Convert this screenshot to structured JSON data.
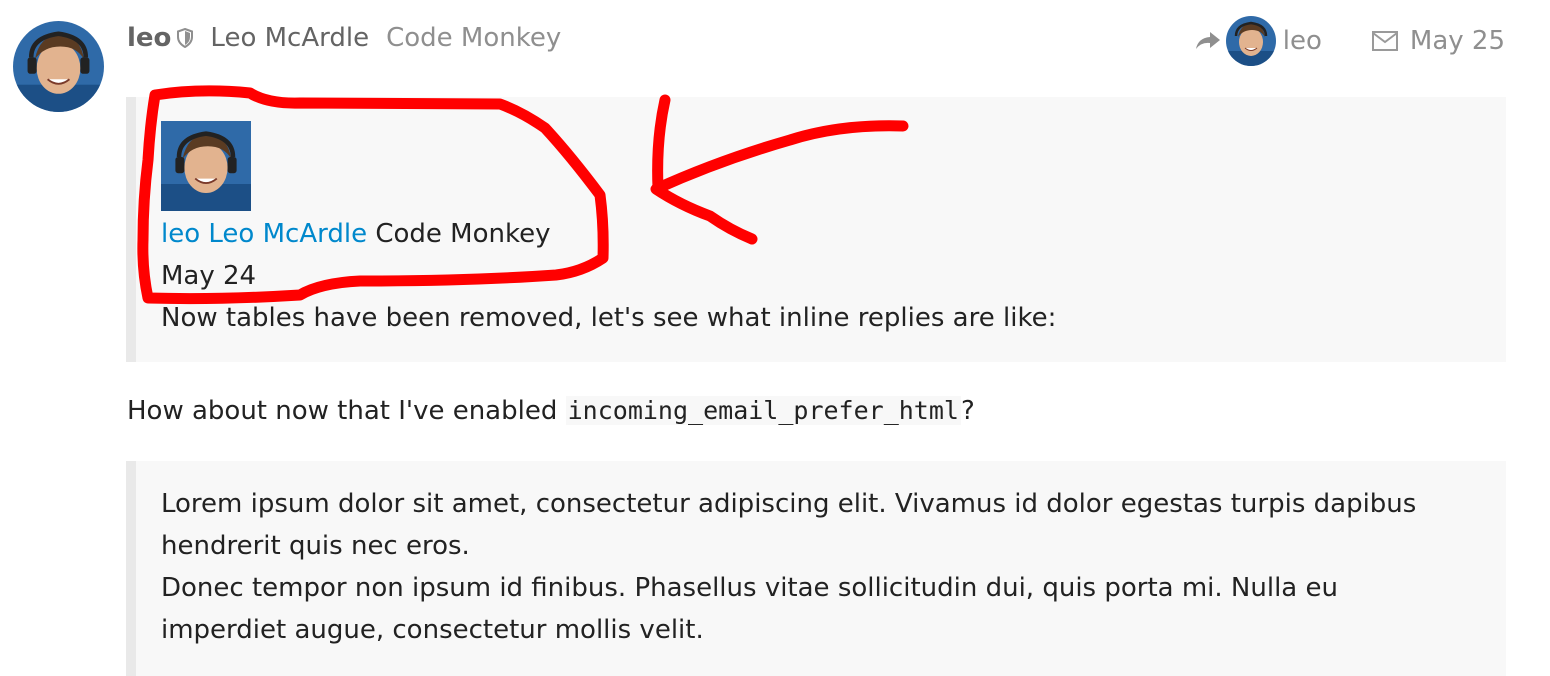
{
  "post": {
    "username": "leo",
    "full_name": "Leo McArdle",
    "user_title": "Code Monkey",
    "reply_to_username": "leo",
    "date": "May 25",
    "avatar_colors": {
      "background": "#2f6aa8",
      "skin": "#e2b38f",
      "hair": "#5a3b22"
    }
  },
  "quote_1": {
    "username": "leo",
    "full_name": "Leo McArdle",
    "user_title": "Code Monkey",
    "date": "May 24",
    "text": "Now tables have been removed, let's see what inline replies are like:"
  },
  "body": {
    "before_code": "How about now that I've enabled ",
    "code": "incoming_email_prefer_html",
    "after_code": "?"
  },
  "quote_2": {
    "line_1": "Lorem ipsum dolor sit amet, consectetur adipiscing elit. Vivamus id dolor egestas turpis dapibus hendrerit quis nec eros.",
    "line_2": "Donec tempor non ipsum id finibus. Phasellus vitae sollicitudin dui, quis porta mi. Nulla eu imperdiet augue, consectetur mollis velit."
  },
  "colors": {
    "link": "#0088cc",
    "muted": "#8f8f8f",
    "annotation": "#ff0000",
    "quote_bg": "#f8f8f8",
    "quote_border": "#e9e9e9"
  },
  "icons": [
    "shield-icon",
    "reply-arrow-icon",
    "mail-icon"
  ]
}
